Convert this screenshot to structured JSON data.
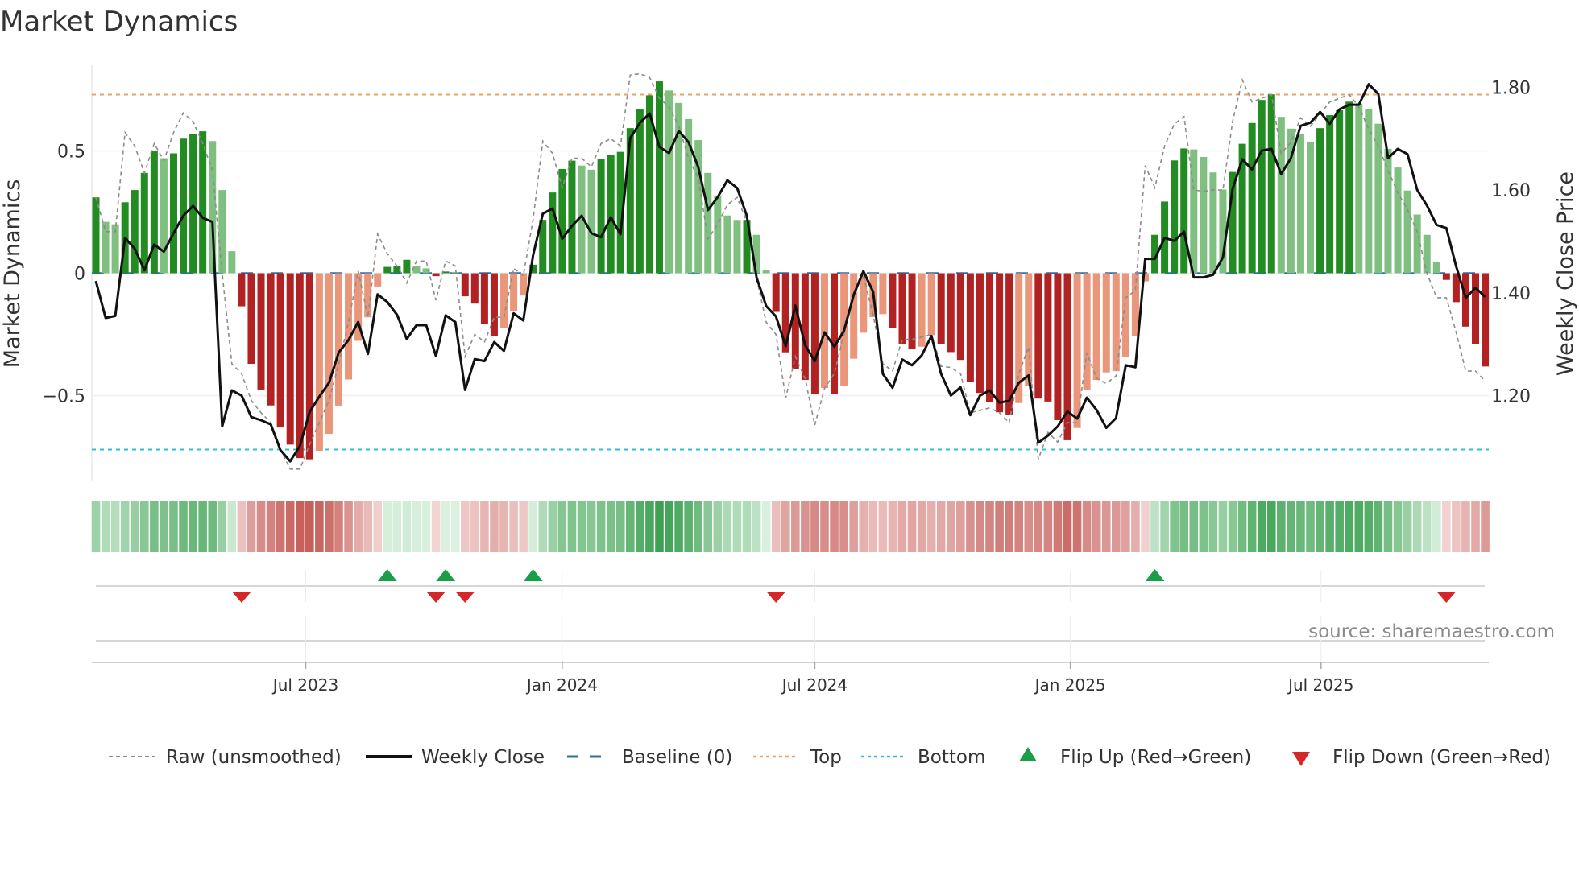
{
  "chart_data": {
    "type": "bar",
    "title": "Market Dynamics",
    "ylabel_left": "Market Dynamics",
    "ylabel_right": "Weekly Close Price",
    "ylim_left": [
      -0.85,
      0.85
    ],
    "ylim_right": [
      1.033,
      1.843
    ],
    "left_ticks": [
      {
        "v": 0.5,
        "label": "0.5"
      },
      {
        "v": 0,
        "label": "0"
      },
      {
        "v": -0.5,
        "label": "−0.5"
      }
    ],
    "right_ticks": [
      {
        "v": 1.8,
        "label": "1.80"
      },
      {
        "v": 1.6,
        "label": "1.60"
      },
      {
        "v": 1.4,
        "label": "1.40"
      },
      {
        "v": 1.2,
        "label": "1.20"
      }
    ],
    "x_ticks": [
      {
        "week": 21.6,
        "label": "Jul 2023"
      },
      {
        "week": 48,
        "label": "Jan 2024"
      },
      {
        "week": 74,
        "label": "Jul 2024"
      },
      {
        "week": 100.3,
        "label": "Jan 2025"
      },
      {
        "week": 126.1,
        "label": "Jul 2025"
      }
    ],
    "top_level": 0.73,
    "bottom_level": -0.72,
    "baseline": 0,
    "momentum": [
      0.31,
      0.21,
      0.2,
      0.29,
      0.34,
      0.41,
      0.5,
      0.47,
      0.49,
      0.55,
      0.57,
      0.58,
      0.54,
      0.34,
      0.09,
      -0.135,
      -0.37,
      -0.475,
      -0.54,
      -0.63,
      -0.7,
      -0.755,
      -0.76,
      -0.725,
      -0.656,
      -0.543,
      -0.434,
      -0.276,
      -0.18,
      -0.054,
      0.026,
      0.028,
      0.055,
      0.028,
      0.02,
      -0.012,
      0.007,
      0.005,
      -0.094,
      -0.124,
      -0.206,
      -0.258,
      -0.222,
      -0.156,
      -0.091,
      0.035,
      0.218,
      0.33,
      0.426,
      0.46,
      0.44,
      0.423,
      0.467,
      0.484,
      0.496,
      0.593,
      0.669,
      0.727,
      0.784,
      0.747,
      0.696,
      0.63,
      0.544,
      0.41,
      0.318,
      0.236,
      0.218,
      0.218,
      0.157,
      0.012,
      -0.158,
      -0.323,
      -0.39,
      -0.436,
      -0.495,
      -0.469,
      -0.495,
      -0.46,
      -0.349,
      -0.243,
      -0.179,
      -0.167,
      -0.222,
      -0.288,
      -0.31,
      -0.3,
      -0.253,
      -0.288,
      -0.322,
      -0.354,
      -0.444,
      -0.489,
      -0.526,
      -0.568,
      -0.577,
      -0.53,
      -0.46,
      -0.512,
      -0.524,
      -0.6,
      -0.682,
      -0.632,
      -0.477,
      -0.436,
      -0.405,
      -0.4,
      -0.343,
      -0.255,
      -0.033,
      0.157,
      0.293,
      0.461,
      0.51,
      0.506,
      0.475,
      0.412,
      0.342,
      0.414,
      0.529,
      0.614,
      0.708,
      0.731,
      0.639,
      0.591,
      0.568,
      0.535,
      0.593,
      0.646,
      0.666,
      0.701,
      0.693,
      0.669,
      0.611,
      0.508,
      0.432,
      0.338,
      0.24,
      0.157,
      0.047,
      -0.027,
      -0.118,
      -0.218,
      -0.29,
      -0.381
    ],
    "raw": [
      0.31,
      0.17,
      0.17,
      0.575,
      0.52,
      0.41,
      0.53,
      0.46,
      0.575,
      0.655,
      0.62,
      0.53,
      0.42,
      0.0,
      -0.37,
      -0.41,
      -0.52,
      -0.57,
      -0.61,
      -0.72,
      -0.8,
      -0.8,
      -0.7,
      -0.61,
      -0.52,
      -0.37,
      -0.2,
      0.01,
      -0.18,
      0.16,
      0.08,
      0.03,
      -0.04,
      0.05,
      0.05,
      -0.11,
      0.05,
      0.03,
      -0.34,
      -0.25,
      -0.28,
      -0.18,
      -0.18,
      0.02,
      -0.01,
      0.22,
      0.54,
      0.49,
      0.35,
      0.47,
      0.47,
      0.435,
      0.53,
      0.55,
      0.52,
      0.81,
      0.815,
      0.8,
      0.715,
      0.68,
      0.6,
      0.47,
      0.39,
      0.14,
      0.2,
      0.28,
      0.31,
      0.21,
      -0.02,
      -0.2,
      -0.25,
      -0.51,
      -0.34,
      -0.43,
      -0.62,
      -0.47,
      -0.41,
      -0.25,
      -0.08,
      -0.01,
      -0.17,
      -0.37,
      -0.4,
      -0.27,
      -0.27,
      -0.26,
      -0.25,
      -0.38,
      -0.385,
      -0.41,
      -0.57,
      -0.56,
      -0.55,
      -0.57,
      -0.61,
      -0.41,
      -0.3,
      -0.76,
      -0.65,
      -0.69,
      -0.61,
      -0.61,
      -0.325,
      -0.43,
      -0.45,
      -0.42,
      -0.1,
      -0.07,
      0.44,
      0.35,
      0.52,
      0.61,
      0.64,
      0.34,
      0.335,
      0.34,
      0.34,
      0.62,
      0.79,
      0.7,
      0.715,
      0.73,
      0.49,
      0.535,
      0.635,
      0.6,
      0.65,
      0.7,
      0.715,
      0.73,
      0.68,
      0.59,
      0.52,
      0.42,
      0.33,
      0.26,
      0.17,
      0.0,
      -0.1,
      -0.1,
      -0.24,
      -0.4,
      -0.4,
      -0.44
    ],
    "weekly_close": [
      1.423,
      1.351,
      1.355,
      1.507,
      1.486,
      1.444,
      1.494,
      1.48,
      1.516,
      1.55,
      1.569,
      1.546,
      1.538,
      1.14,
      1.21,
      1.2,
      1.158,
      1.152,
      1.144,
      1.094,
      1.072,
      1.102,
      1.168,
      1.198,
      1.225,
      1.284,
      1.308,
      1.343,
      1.281,
      1.397,
      1.382,
      1.357,
      1.31,
      1.337,
      1.337,
      1.277,
      1.356,
      1.343,
      1.211,
      1.271,
      1.267,
      1.304,
      1.287,
      1.36,
      1.346,
      1.473,
      1.554,
      1.564,
      1.505,
      1.53,
      1.55,
      1.516,
      1.508,
      1.547,
      1.514,
      1.701,
      1.731,
      1.749,
      1.684,
      1.672,
      1.715,
      1.693,
      1.645,
      1.561,
      1.586,
      1.619,
      1.604,
      1.55,
      1.43,
      1.374,
      1.354,
      1.296,
      1.375,
      1.298,
      1.267,
      1.323,
      1.295,
      1.326,
      1.396,
      1.442,
      1.402,
      1.242,
      1.215,
      1.27,
      1.259,
      1.278,
      1.316,
      1.242,
      1.2,
      1.216,
      1.162,
      1.2,
      1.21,
      1.186,
      1.19,
      1.225,
      1.239,
      1.108,
      1.122,
      1.14,
      1.169,
      1.155,
      1.196,
      1.172,
      1.137,
      1.156,
      1.259,
      1.255,
      1.466,
      1.466,
      1.507,
      1.501,
      1.519,
      1.43,
      1.43,
      1.435,
      1.469,
      1.602,
      1.66,
      1.64,
      1.677,
      1.68,
      1.631,
      1.662,
      1.725,
      1.731,
      1.752,
      1.729,
      1.757,
      1.766,
      1.766,
      1.806,
      1.787,
      1.662,
      1.68,
      1.67,
      1.6,
      1.57,
      1.532,
      1.526,
      1.452,
      1.39,
      1.41,
      1.392
    ],
    "flip_up_weeks": [
      30,
      36,
      45,
      109
    ],
    "flip_down_weeks": [
      15,
      35,
      38,
      70,
      139
    ],
    "legend": [
      {
        "key": "raw",
        "label": "Raw (unsmoothed)"
      },
      {
        "key": "close",
        "label": "Weekly Close"
      },
      {
        "key": "baseline",
        "label": "Baseline (0)"
      },
      {
        "key": "top",
        "label": "Top"
      },
      {
        "key": "bottom",
        "label": "Bottom"
      },
      {
        "key": "flipup",
        "label": "Flip Up (Red→Green)"
      },
      {
        "key": "flipdown",
        "label": "Flip Down (Green→Red)"
      }
    ],
    "legend_placement": "bottom",
    "grid": true
  },
  "source": "source: sharemaestro.com",
  "colors": {
    "green_strong": "#228b22",
    "green_weak": "#7fbf7f",
    "red_strong": "#b22222",
    "red_weak": "#e9967a",
    "raw": "#8c8c8c",
    "close": "#111111",
    "baseline": "#2f6fa7",
    "top": "#f0a060",
    "bottom": "#30c0d0",
    "flip_up": "#1a9e48",
    "flip_down": "#d62728"
  }
}
